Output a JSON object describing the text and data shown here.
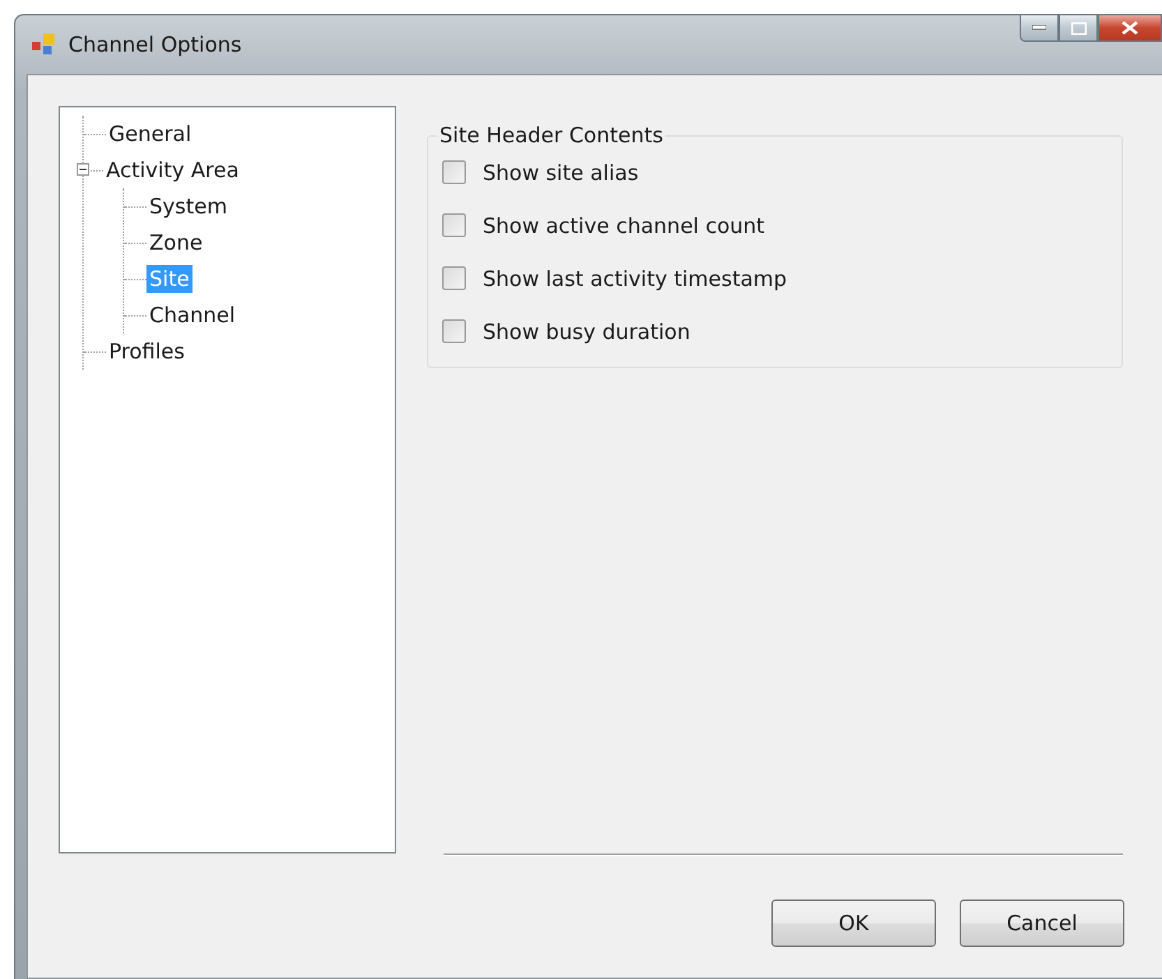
{
  "window": {
    "title": "Channel Options"
  },
  "tree": [
    {
      "label": "General",
      "selected": false
    },
    {
      "label": "Activity Area",
      "selected": false,
      "expanded": true,
      "children": [
        {
          "label": "System",
          "selected": false
        },
        {
          "label": "Zone",
          "selected": false
        },
        {
          "label": "Site",
          "selected": true
        },
        {
          "label": "Channel",
          "selected": false
        }
      ]
    },
    {
      "label": "Profiles",
      "selected": false
    }
  ],
  "group": {
    "title": "Site Header Contents",
    "options": [
      {
        "label": "Show site alias",
        "checked": false
      },
      {
        "label": "Show active channel count",
        "checked": false
      },
      {
        "label": "Show last activity timestamp",
        "checked": false
      },
      {
        "label": "Show busy duration",
        "checked": false
      }
    ]
  },
  "buttons": [
    "OK",
    "Cancel"
  ]
}
